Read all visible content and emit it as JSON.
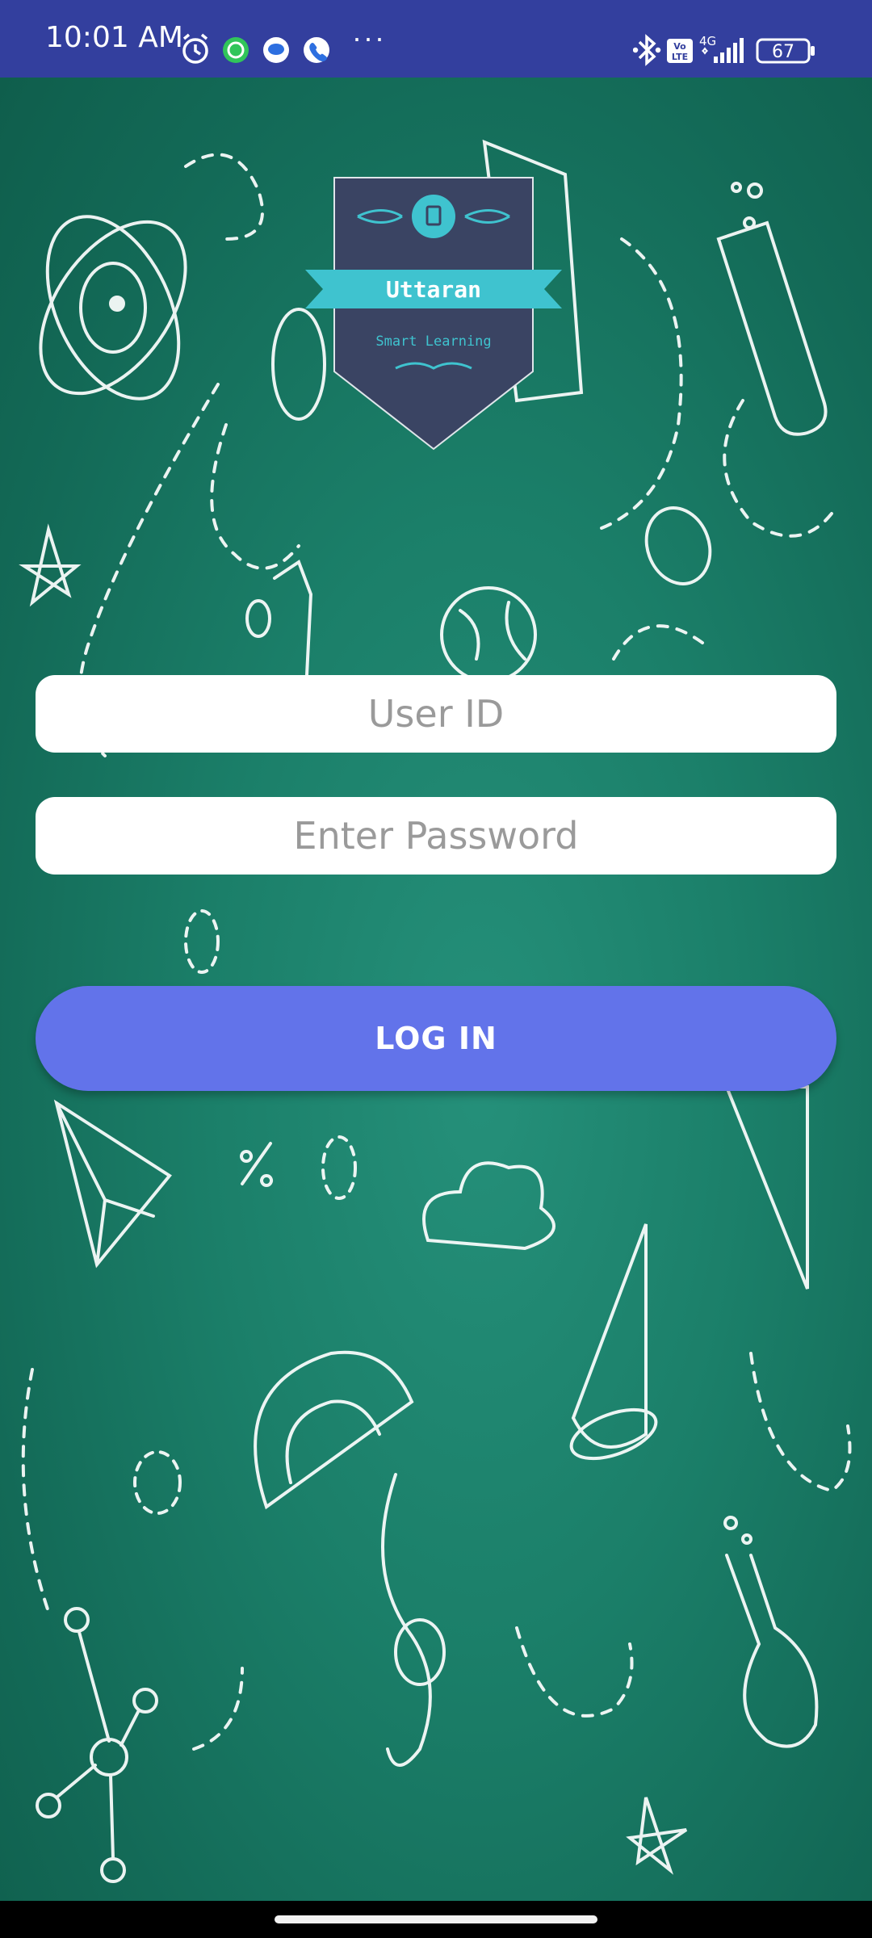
{
  "status_bar": {
    "time": "10:01 AM",
    "battery_level": "67",
    "network": "4G",
    "volte": "Vo LTE",
    "more_dots": "···",
    "icons": [
      "alarm-icon",
      "whatsapp-icon",
      "messages-icon",
      "phone-icon",
      "bluetooth-icon",
      "volte-icon",
      "signal-icon",
      "battery-icon"
    ]
  },
  "logo": {
    "name": "Uttaran",
    "tagline": "Smart Learning"
  },
  "form": {
    "user_id_placeholder": "User ID",
    "password_placeholder": "Enter Password",
    "login_label": "LOG IN"
  },
  "colors": {
    "status_bar": "#333f9e",
    "background": "#1b7f69",
    "login_button": "#6273ea",
    "logo_shield": "#3a4463",
    "logo_ribbon": "#3fc3cf"
  }
}
